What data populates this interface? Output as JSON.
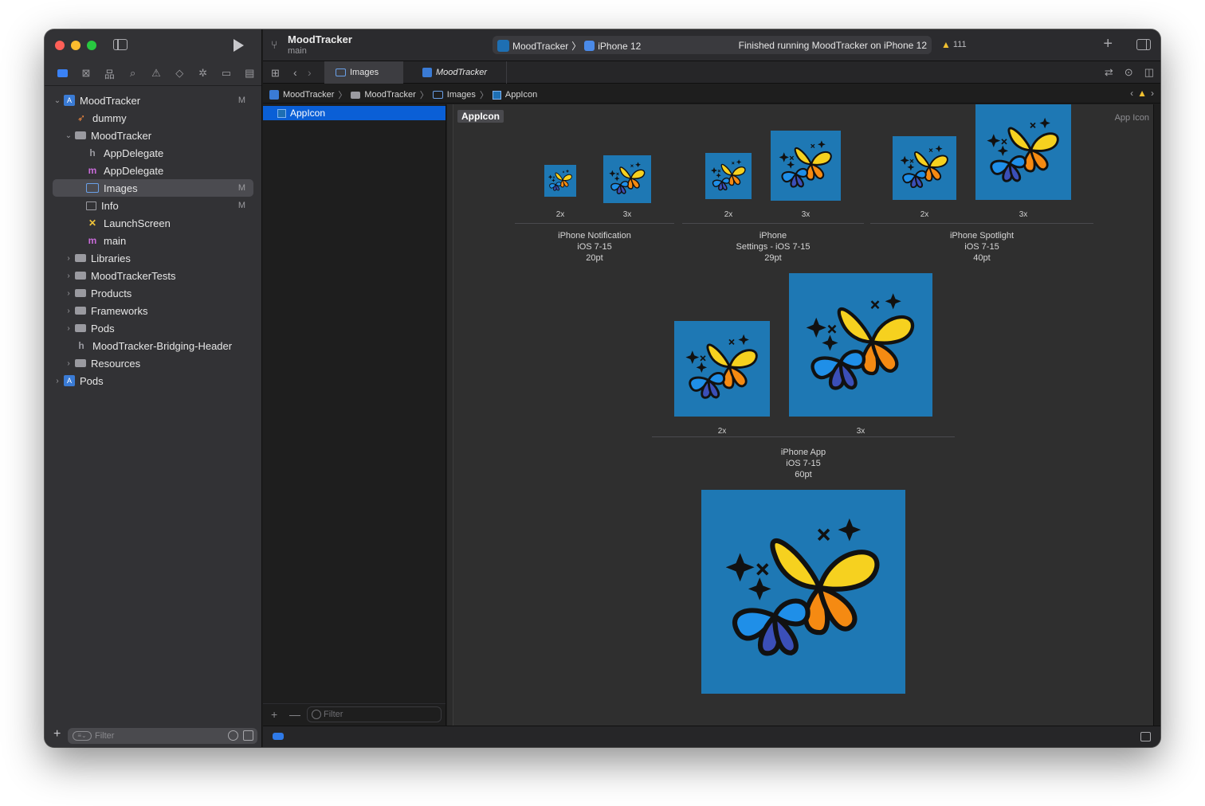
{
  "toolbar": {
    "project_name": "MoodTracker",
    "branch": "main",
    "scheme": "MoodTracker",
    "device": "iPhone 12",
    "status_message": "Finished running MoodTracker on iPhone 12",
    "warning_count": "111"
  },
  "tabs": [
    {
      "label": "Images"
    },
    {
      "label": "MoodTracker"
    }
  ],
  "breadcrumb": [
    "MoodTracker",
    "MoodTracker",
    "Images",
    "AppIcon"
  ],
  "sidebar": {
    "filter_placeholder": "Filter",
    "items": [
      {
        "label": "MoodTracker",
        "badge": "M"
      },
      {
        "label": "dummy",
        "badge": ""
      },
      {
        "label": "MoodTracker",
        "badge": ""
      },
      {
        "label": "AppDelegate",
        "badge": ""
      },
      {
        "label": "AppDelegate",
        "badge": ""
      },
      {
        "label": "Images",
        "badge": "M"
      },
      {
        "label": "Info",
        "badge": "M"
      },
      {
        "label": "LaunchScreen",
        "badge": ""
      },
      {
        "label": "main",
        "badge": ""
      },
      {
        "label": "Libraries",
        "badge": ""
      },
      {
        "label": "MoodTrackerTests",
        "badge": ""
      },
      {
        "label": "Products",
        "badge": ""
      },
      {
        "label": "Frameworks",
        "badge": ""
      },
      {
        "label": "Pods",
        "badge": ""
      },
      {
        "label": "MoodTracker-Bridging-Header",
        "badge": ""
      },
      {
        "label": "Resources",
        "badge": ""
      },
      {
        "label": "Pods",
        "badge": ""
      }
    ]
  },
  "asset_list": {
    "selected": "AppIcon",
    "filter_placeholder": "Filter"
  },
  "editor": {
    "asset_name": "AppIcon",
    "asset_type": "App Icon",
    "scale_labels": [
      "2x",
      "3x"
    ],
    "groups": [
      {
        "line1": "iPhone Notification",
        "line2": "iOS 7-15",
        "line3": "20pt"
      },
      {
        "line1": "iPhone",
        "line2": "Settings - iOS 7-15",
        "line3": "29pt"
      },
      {
        "line1": "iPhone Spotlight",
        "line2": "iOS 7-15",
        "line3": "40pt"
      },
      {
        "line1": "iPhone App",
        "line2": "iOS 7-15",
        "line3": "60pt"
      }
    ]
  },
  "colors": {
    "icon_background": "#1e78b4",
    "selection": "#0a5fd6",
    "accent": "#3a82f6",
    "warning": "#f0c030"
  }
}
